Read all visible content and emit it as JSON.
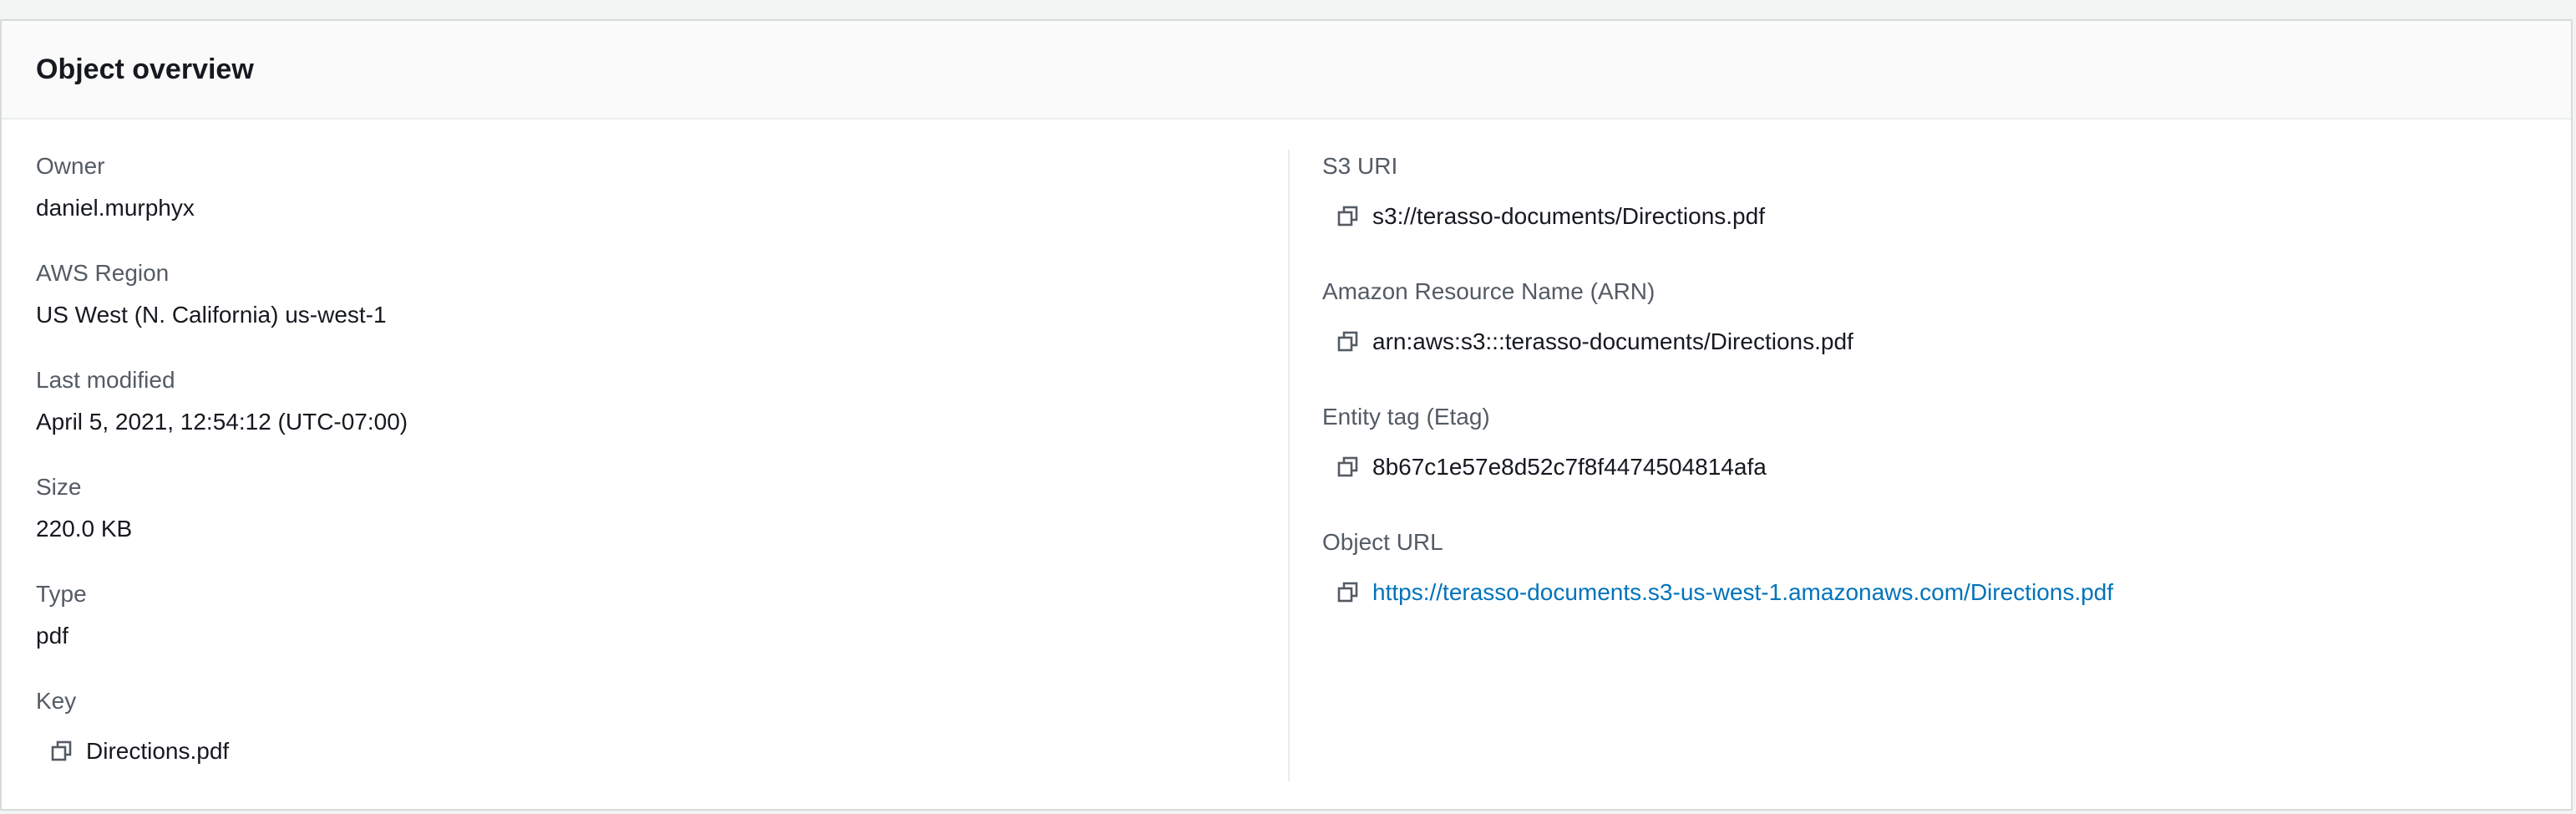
{
  "panel": {
    "title": "Object overview"
  },
  "left": {
    "owner": {
      "label": "Owner",
      "value": "daniel.murphyx"
    },
    "region": {
      "label": "AWS Region",
      "value": "US West (N. California) us-west-1"
    },
    "last_modified": {
      "label": "Last modified",
      "value": "April 5, 2021, 12:54:12 (UTC-07:00)"
    },
    "size": {
      "label": "Size",
      "value": "220.0 KB"
    },
    "type": {
      "label": "Type",
      "value": "pdf"
    },
    "key": {
      "label": "Key",
      "value": "Directions.pdf"
    }
  },
  "right": {
    "s3_uri": {
      "label": "S3 URI",
      "value": "s3://terasso-documents/Directions.pdf"
    },
    "arn": {
      "label": "Amazon Resource Name (ARN)",
      "value": "arn:aws:s3:::terasso-documents/Directions.pdf"
    },
    "etag": {
      "label": "Entity tag (Etag)",
      "value": "8b67c1e57e8d52c7f8f4474504814afa"
    },
    "object_url": {
      "label": "Object URL",
      "value": "https://terasso-documents.s3-us-west-1.amazonaws.com/Directions.pdf"
    }
  },
  "colors": {
    "link": "#0073bb",
    "label": "#545b64",
    "text": "#16191f"
  },
  "icons": {
    "copy": "copy-icon"
  }
}
